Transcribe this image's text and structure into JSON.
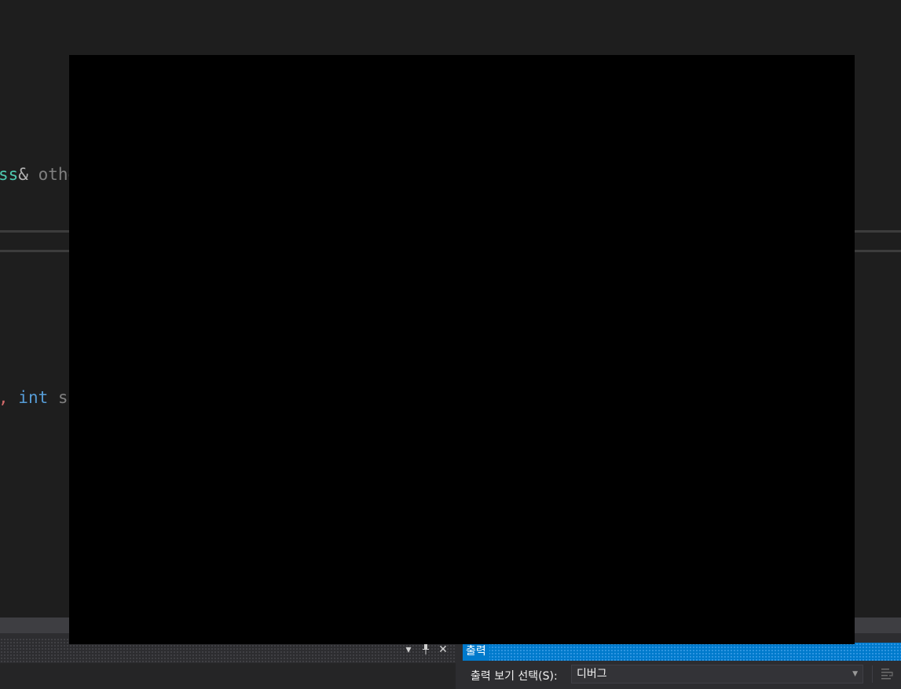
{
  "editor": {
    "line1": {
      "type_tail": "ss",
      "amp": "&",
      "param": " othe"
    },
    "line2": {
      "comma": ",",
      "keyword": " int",
      "param": " sc"
    }
  },
  "output": {
    "title": "출력",
    "source_label": "출력 보기 선택(S):",
    "source_value": "디버그"
  },
  "left_panel": {
    "tools": {
      "dropdown": "▾",
      "pin": "🖈",
      "close": "✕"
    }
  },
  "colors": {
    "editor_bg": "#1e1e1e",
    "accent": "#007acc",
    "overlay": "#000000"
  }
}
